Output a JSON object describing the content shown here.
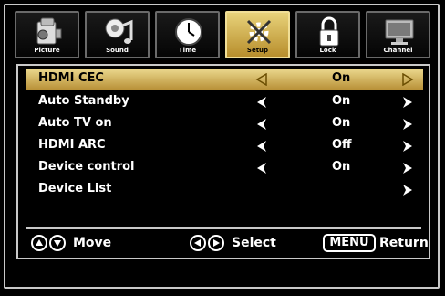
{
  "tabs": [
    {
      "label": "Picture",
      "icon": "camera-icon",
      "active": false
    },
    {
      "label": "Sound",
      "icon": "music-note-icon",
      "active": false
    },
    {
      "label": "Time",
      "icon": "clock-icon",
      "active": false
    },
    {
      "label": "Setup",
      "icon": "tools-icon",
      "active": true
    },
    {
      "label": "Lock",
      "icon": "padlock-icon",
      "active": false
    },
    {
      "label": "Channel",
      "icon": "monitor-icon",
      "active": false
    }
  ],
  "menu": [
    {
      "name": "HDMI CEC",
      "value": "On",
      "left_arrow": true,
      "right_arrow": true,
      "selected": true
    },
    {
      "name": "Auto Standby",
      "value": "On",
      "left_arrow": true,
      "right_arrow": true,
      "selected": false
    },
    {
      "name": "Auto TV on",
      "value": "On",
      "left_arrow": true,
      "right_arrow": true,
      "selected": false
    },
    {
      "name": "HDMI ARC",
      "value": "Off",
      "left_arrow": true,
      "right_arrow": true,
      "selected": false
    },
    {
      "name": "Device control",
      "value": "On",
      "left_arrow": true,
      "right_arrow": true,
      "selected": false
    },
    {
      "name": "Device List",
      "value": "",
      "left_arrow": false,
      "right_arrow": true,
      "selected": false
    }
  ],
  "legend": {
    "move": "Move",
    "select": "Select",
    "menu_key": "MENU",
    "return": "Return"
  },
  "colors": {
    "accent": "#d9bf62",
    "accent_dark": "#b88e2c",
    "border": "#c9c9c9"
  }
}
